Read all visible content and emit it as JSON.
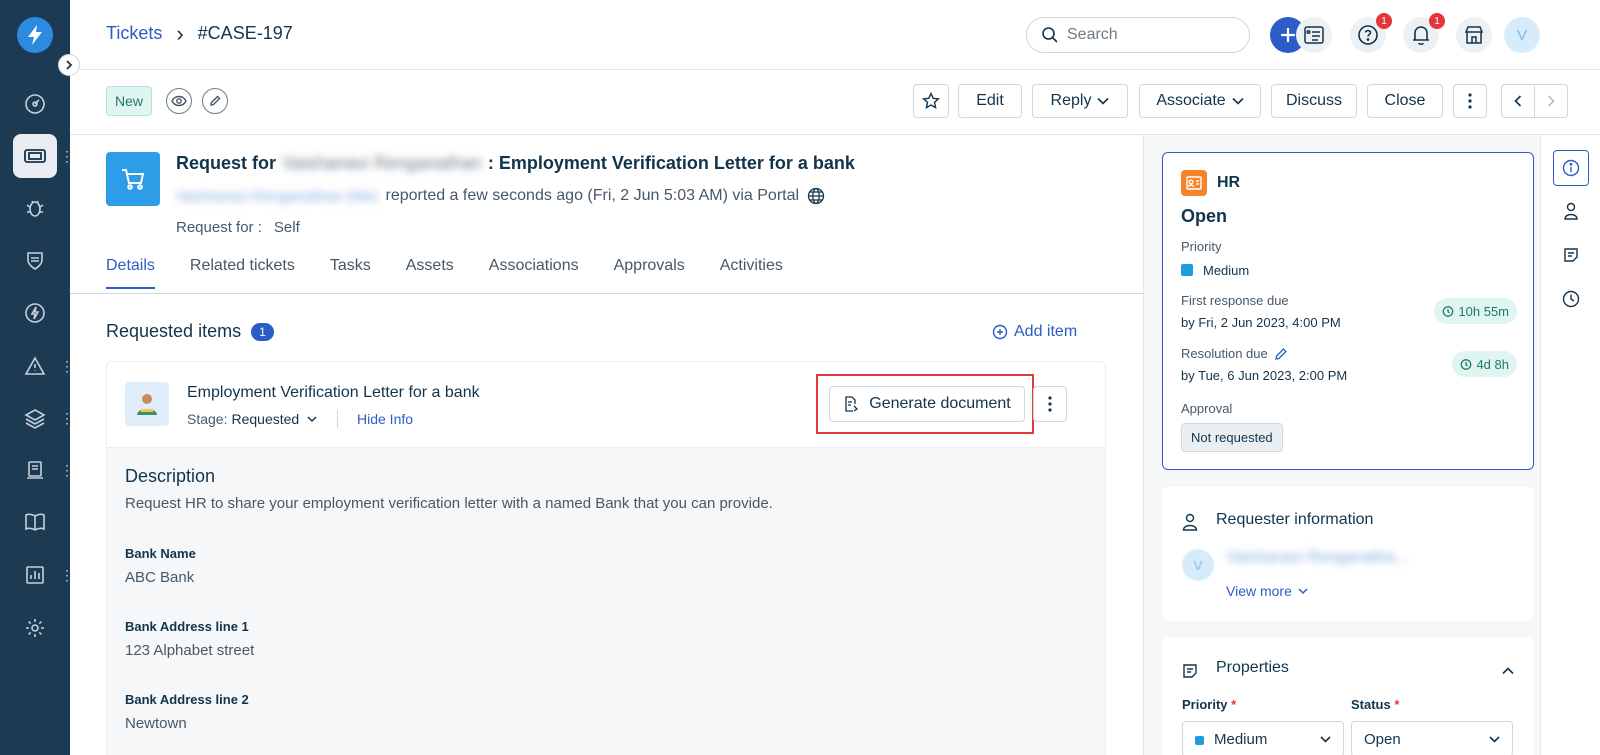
{
  "breadcrumb": {
    "parent": "Tickets",
    "separator": "›",
    "current": "#CASE-197"
  },
  "header": {
    "search_placeholder": "Search",
    "help_badge": "1",
    "notifications_badge": "1",
    "avatar_initial": "V"
  },
  "actionbar": {
    "status_tag": "New",
    "edit": "Edit",
    "reply": "Reply",
    "associate": "Associate",
    "discuss": "Discuss",
    "close": "Close"
  },
  "ticket": {
    "subject_prefix": "Request for",
    "requester_name": "Vaishanavi Renganathan",
    "subject_suffix": ": Employment Verification Letter for a bank",
    "reporter": "Vaishanavi Renganathan (Me)",
    "reported_text": "reported a few seconds ago (Fri, 2 Jun 5:03 AM) via Portal",
    "request_for_label": "Request for :",
    "request_for_value": "Self"
  },
  "tabs": [
    "Details",
    "Related tickets",
    "Tasks",
    "Assets",
    "Associations",
    "Approvals",
    "Activities"
  ],
  "requested_items": {
    "title": "Requested items",
    "count": "1",
    "add_item": "Add item",
    "item": {
      "name": "Employment Verification Letter for a bank",
      "stage_label": "Stage:",
      "stage_value": "Requested",
      "hide_info": "Hide Info",
      "generate_document": "Generate document"
    },
    "description_title": "Description",
    "description_text": "Request HR to share your employment verification letter with a named Bank that you can provide.",
    "fields": [
      {
        "label": "Bank Name",
        "value": "ABC Bank"
      },
      {
        "label": "Bank Address line 1",
        "value": "123 Alphabet street"
      },
      {
        "label": "Bank Address line 2",
        "value": "Newtown"
      }
    ]
  },
  "status_card": {
    "workspace": "HR",
    "status": "Open",
    "priority_label": "Priority",
    "priority_value": "Medium",
    "first_response_label": "First response due",
    "first_response_value": "by Fri, 2 Jun 2023, 4:00 PM",
    "first_response_timer": "10h 55m",
    "resolution_label": "Resolution due",
    "resolution_value": "by Tue, 6 Jun 2023, 2:00 PM",
    "resolution_timer": "4d 8h",
    "approval_label": "Approval",
    "approval_value": "Not requested"
  },
  "requester_card": {
    "title": "Requester information",
    "avatar_initial": "V",
    "name": "Vaishanavi Renganatha...",
    "view_more": "View more"
  },
  "properties_card": {
    "title": "Properties",
    "priority_label": "Priority",
    "priority_value": "Medium",
    "status_label": "Status",
    "status_value": "Open",
    "required_mark": "*"
  },
  "colors": {
    "accent": "#2c5cc5",
    "rail": "#1c3a52",
    "highlight": "#e03c3c",
    "priority_medium": "#1f9be0"
  }
}
